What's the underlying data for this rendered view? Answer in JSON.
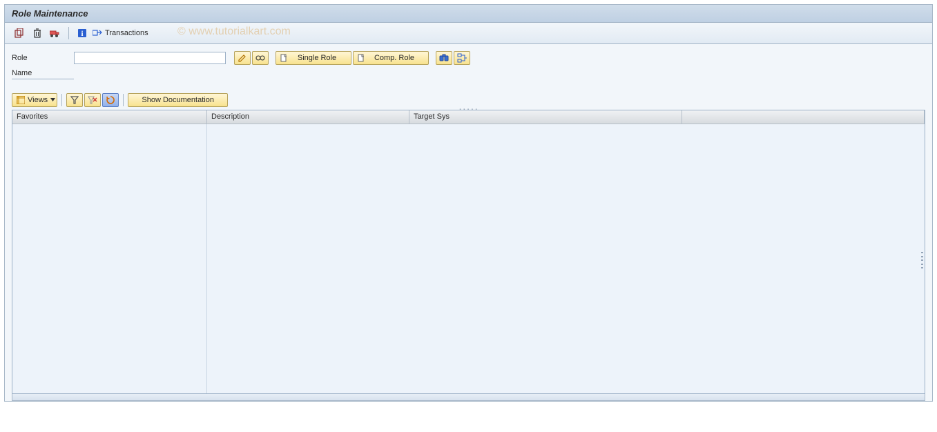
{
  "title": "Role Maintenance",
  "watermark": "© www.tutorialkart.com",
  "toolbar": {
    "transactions_label": "Transactions"
  },
  "fields": {
    "role_label": "Role",
    "role_value": "",
    "name_label": "Name",
    "name_value": ""
  },
  "buttons": {
    "single_role": "Single Role",
    "comp_role": "Comp. Role",
    "views": "Views",
    "show_doc": "Show Documentation"
  },
  "grid_headers": {
    "favorites": "Favorites",
    "description": "Description",
    "target_sys": "Target Sys"
  }
}
